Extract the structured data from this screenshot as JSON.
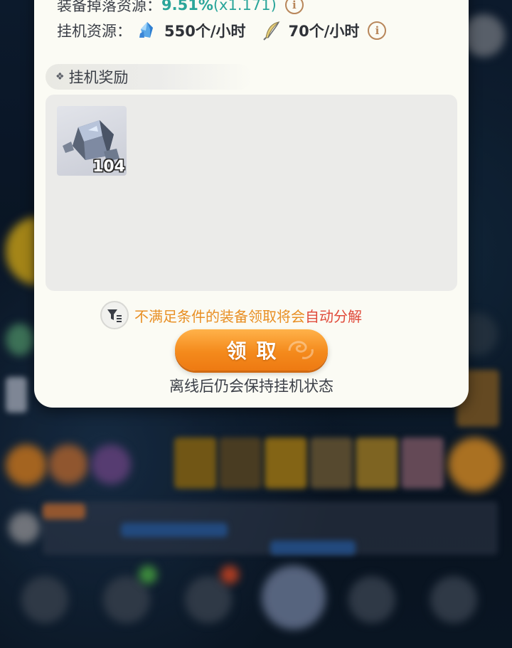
{
  "idle_panel": {
    "equip_drop_label": "装备掉落资源：",
    "equip_drop_rate": "9.51%",
    "equip_drop_multiplier": "(x1.171)",
    "idle_resources_label": "挂机资源：",
    "resources": [
      {
        "icon": "blue-crystal-icon",
        "value": "550个/小时"
      },
      {
        "icon": "feather-quill-icon",
        "value": "70个/小时"
      }
    ],
    "info_glyph": "i",
    "section_title": "挂机奖励",
    "section_marker": "❖",
    "rewards": [
      {
        "icon": "ore-stone-icon",
        "quantity": "104"
      }
    ],
    "notice_prefix": "不满足条件的装备领取将会",
    "notice_highlight": "自动分解",
    "claim_label": "领取",
    "footer_note": "离线后仍会保持挂机状态"
  },
  "colors": {
    "teal": "#2aa59a",
    "orange_text": "#e88f24",
    "red_text": "#e04a3a",
    "button_orange": "#f48a1c",
    "panel_bg": "#fbfbf4"
  }
}
